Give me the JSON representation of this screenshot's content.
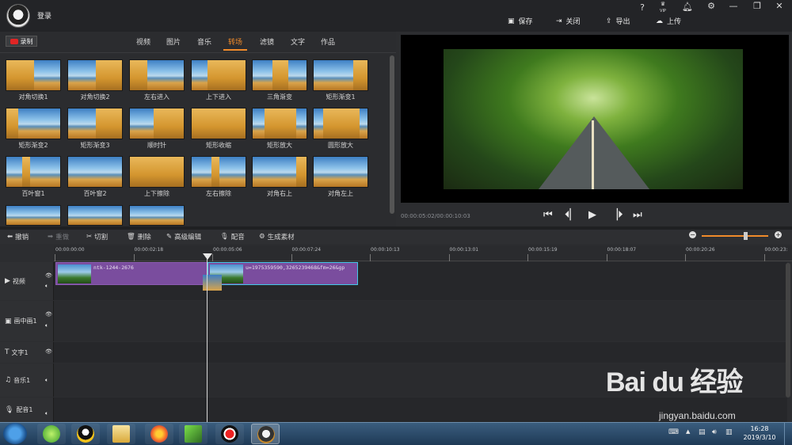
{
  "header": {
    "login": "登录",
    "actions": [
      {
        "label": "保存",
        "icon": "save-icon"
      },
      {
        "label": "关闭",
        "icon": "close-file-icon"
      },
      {
        "label": "导出",
        "icon": "export-icon"
      },
      {
        "label": "上传",
        "icon": "upload-icon"
      }
    ],
    "sys": {
      "help": "?",
      "vip": "VIP"
    }
  },
  "record": {
    "label": "录制"
  },
  "tabs": [
    "视频",
    "图片",
    "音乐",
    "转场",
    "滤镜",
    "文字",
    "作品"
  ],
  "active_tab": "转场",
  "transitions": [
    "对角切换1",
    "对角切换2",
    "左右进入",
    "上下进入",
    "三角渐变",
    "矩形渐变1",
    "矩形渐变2",
    "矩形渐变3",
    "顺时针",
    "矩形收缩",
    "矩形放大",
    "圆形放大",
    "百叶窗1",
    "百叶窗2",
    "上下擦除",
    "左右擦除",
    "对角右上",
    "对角左上",
    "",
    "",
    ""
  ],
  "preview": {
    "time": "00:00:05:02/00:00:10:03"
  },
  "edit_tools": {
    "undo": "撤销",
    "redo": "重做",
    "cut": "切割",
    "delete": "删除",
    "advanced": "高级编辑",
    "dub": "配音",
    "generate": "生成素材"
  },
  "ruler": [
    "00:00:00:00",
    "00:00:02:18",
    "00:00:05:06",
    "00:00:07:24",
    "00:00:10:13",
    "00:00:13:01",
    "00:00:15:19",
    "00:00:18:07",
    "00:00:20:26",
    "00:00:23:"
  ],
  "tracks": [
    {
      "label": "视频"
    },
    {
      "label": "画中画1"
    },
    {
      "label": "文字1"
    },
    {
      "label": "音乐1"
    },
    {
      "label": "配音1"
    }
  ],
  "clips": [
    {
      "name": "ntk-1244-2676"
    },
    {
      "name": "u=1975359590,3265239468&fm=26&gp"
    }
  ],
  "taskbar": {
    "time": "16:28",
    "date": "2019/3/10"
  },
  "watermark": {
    "brand": "Bai du 经验",
    "url": "jingyan.baidu.com"
  }
}
